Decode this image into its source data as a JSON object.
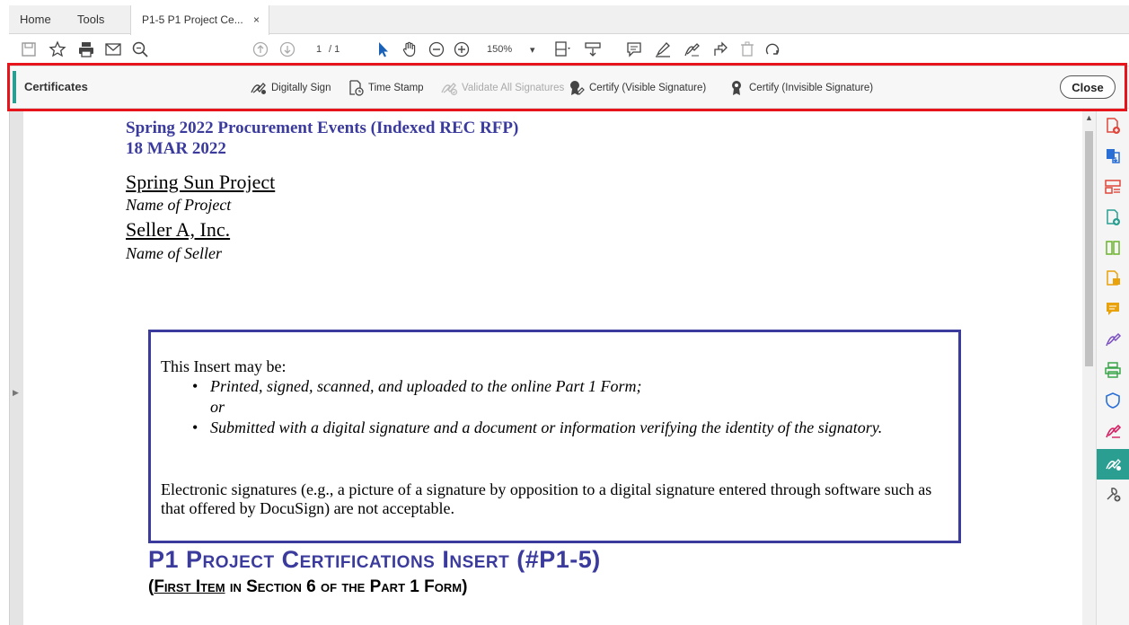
{
  "tabs": {
    "home": "Home",
    "tools": "Tools",
    "document": "P1-5 P1 Project Ce...",
    "document_close": "×"
  },
  "toolbar": {
    "page_current": "1",
    "page_total": "/ 1",
    "zoom": "150%",
    "zoom_caret": "▾"
  },
  "certificates": {
    "title": "Certificates",
    "tools": [
      {
        "label": "Digitally Sign",
        "enabled": true
      },
      {
        "label": "Time Stamp",
        "enabled": true
      },
      {
        "label": "Validate All Signatures",
        "enabled": false
      },
      {
        "label": "Certify (Visible Signature)",
        "enabled": true
      },
      {
        "label": "Certify (Invisible Signature)",
        "enabled": true
      }
    ],
    "close_label": "Close"
  },
  "document": {
    "heading_line1": "Spring 2022 Procurement Events (Indexed REC RFP)",
    "heading_line2": "18 MAR 2022",
    "project_name": "Spring Sun Project",
    "project_caption": "Name of Project",
    "seller_name": "Seller A, Inc.",
    "seller_caption": "Name of Seller",
    "insert_intro": "This Insert may be:",
    "bullet1": "Printed, signed, scanned, and uploaded to the online Part 1 Form;",
    "bullet1_or": "or",
    "bullet2": "Submitted with a digital signature and a document or information verifying the identity of the signatory.",
    "insert_note": "Electronic signatures (e.g., a picture of a signature by opposition to a digital signature entered through software such as that offered by DocuSign) are not acceptable.",
    "big_title": "P1 Project Certifications Insert (#P1-5)",
    "sub_title_open": "(",
    "sub_title_underlined": "First Item",
    "sub_title_rest": " in Section 6 of the Part 1 Form)"
  },
  "colors": {
    "accent": "#2a9e91",
    "heading_blue": "#3b3b9e",
    "highlight_red": "#e8141b"
  },
  "rail_icons": [
    "create-pdf-icon",
    "export-pdf-icon",
    "organize-pages-icon",
    "edit-pdf-icon",
    "compare-icon",
    "combine-files-icon",
    "comment-icon",
    "fill-sign-icon",
    "print-production-icon",
    "protect-icon",
    "request-signature-icon",
    "certificates-icon",
    "more-tools-icon"
  ]
}
